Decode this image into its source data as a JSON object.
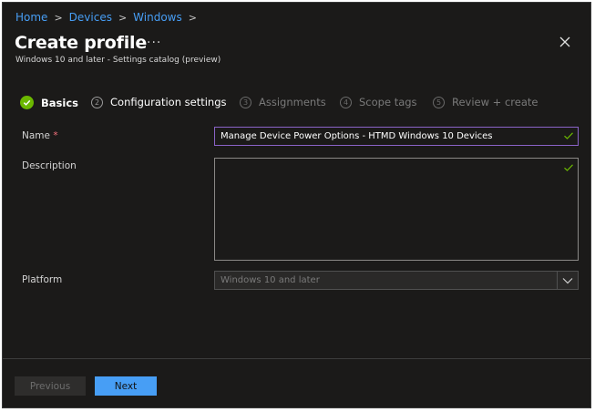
{
  "breadcrumb": {
    "items": [
      "Home",
      "Devices",
      "Windows"
    ]
  },
  "header": {
    "title": "Create profile",
    "more_label": "···",
    "subtitle": "Windows 10 and later - Settings catalog (preview)"
  },
  "steps": [
    {
      "number": "",
      "label": "Basics",
      "state": "active"
    },
    {
      "number": "2",
      "label": "Configuration settings",
      "state": "current"
    },
    {
      "number": "3",
      "label": "Assignments",
      "state": "inactive"
    },
    {
      "number": "4",
      "label": "Scope tags",
      "state": "inactive"
    },
    {
      "number": "5",
      "label": "Review + create",
      "state": "inactive"
    }
  ],
  "form": {
    "name_label": "Name",
    "required_mark": "*",
    "name_value": "Manage Device Power Options - HTMD Windows 10 Devices",
    "description_label": "Description",
    "description_value": "",
    "platform_label": "Platform",
    "platform_value": "Windows 10 and later"
  },
  "footer": {
    "previous_label": "Previous",
    "next_label": "Next"
  },
  "colors": {
    "accent": "#479ef5",
    "success": "#6bb700",
    "panel_bg": "#1b1a19",
    "focus_border": "#8a63c7"
  }
}
